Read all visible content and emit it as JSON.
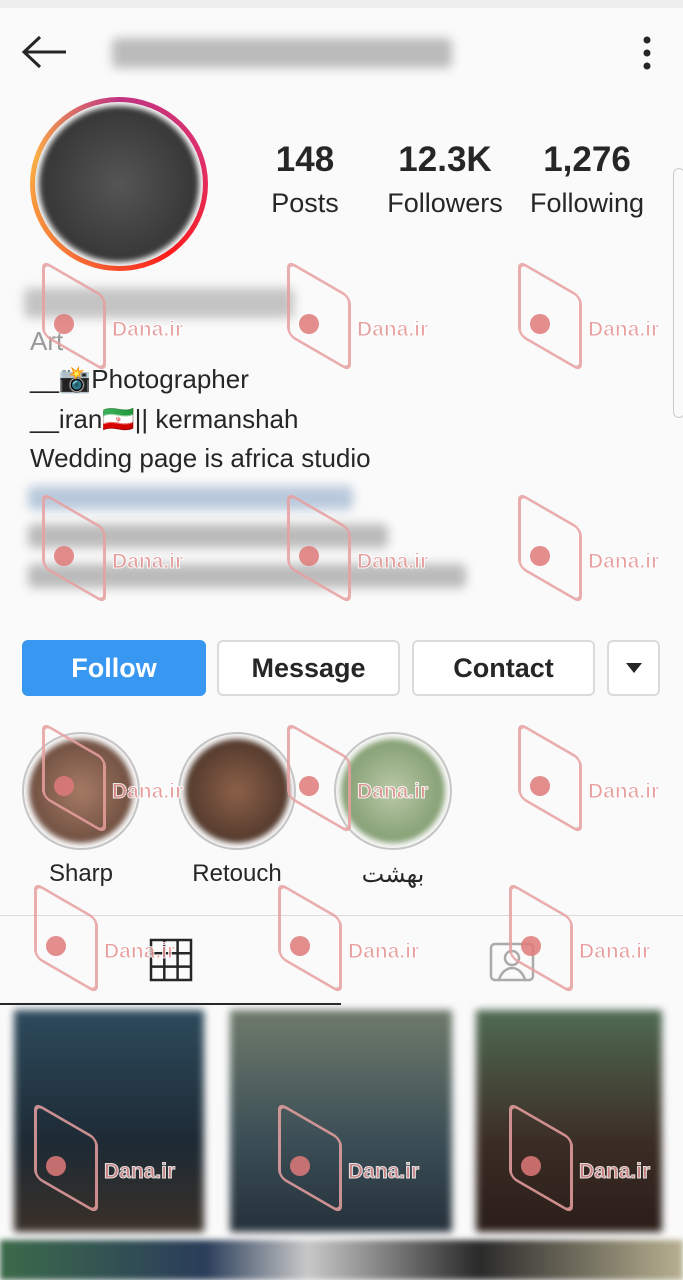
{
  "header": {
    "back_icon": "arrow-left-icon",
    "more_icon": "more-vertical-icon"
  },
  "stats": [
    {
      "value": "148",
      "label": "Posts"
    },
    {
      "value": "12.3K",
      "label": "Followers"
    },
    {
      "value": "1,276",
      "label": "Following"
    }
  ],
  "bio": {
    "category": "Art",
    "lines": [
      "__📸Photographer",
      "__iran🇮🇷|| kermanshah",
      "Wedding page is africa studio"
    ]
  },
  "buttons": {
    "follow": "Follow",
    "message": "Message",
    "contact": "Contact",
    "dropdown_icon": "caret-down-icon"
  },
  "highlights": [
    {
      "label": "Sharp"
    },
    {
      "label": "Retouch"
    },
    {
      "label": "بهشت"
    }
  ],
  "tabs": [
    {
      "icon": "grid-icon",
      "active": true
    },
    {
      "icon": "tagged-icon",
      "active": false
    }
  ],
  "colors": {
    "accent": "#3897f0",
    "story_ring": "#c13584"
  },
  "watermark": "Dana.ir"
}
